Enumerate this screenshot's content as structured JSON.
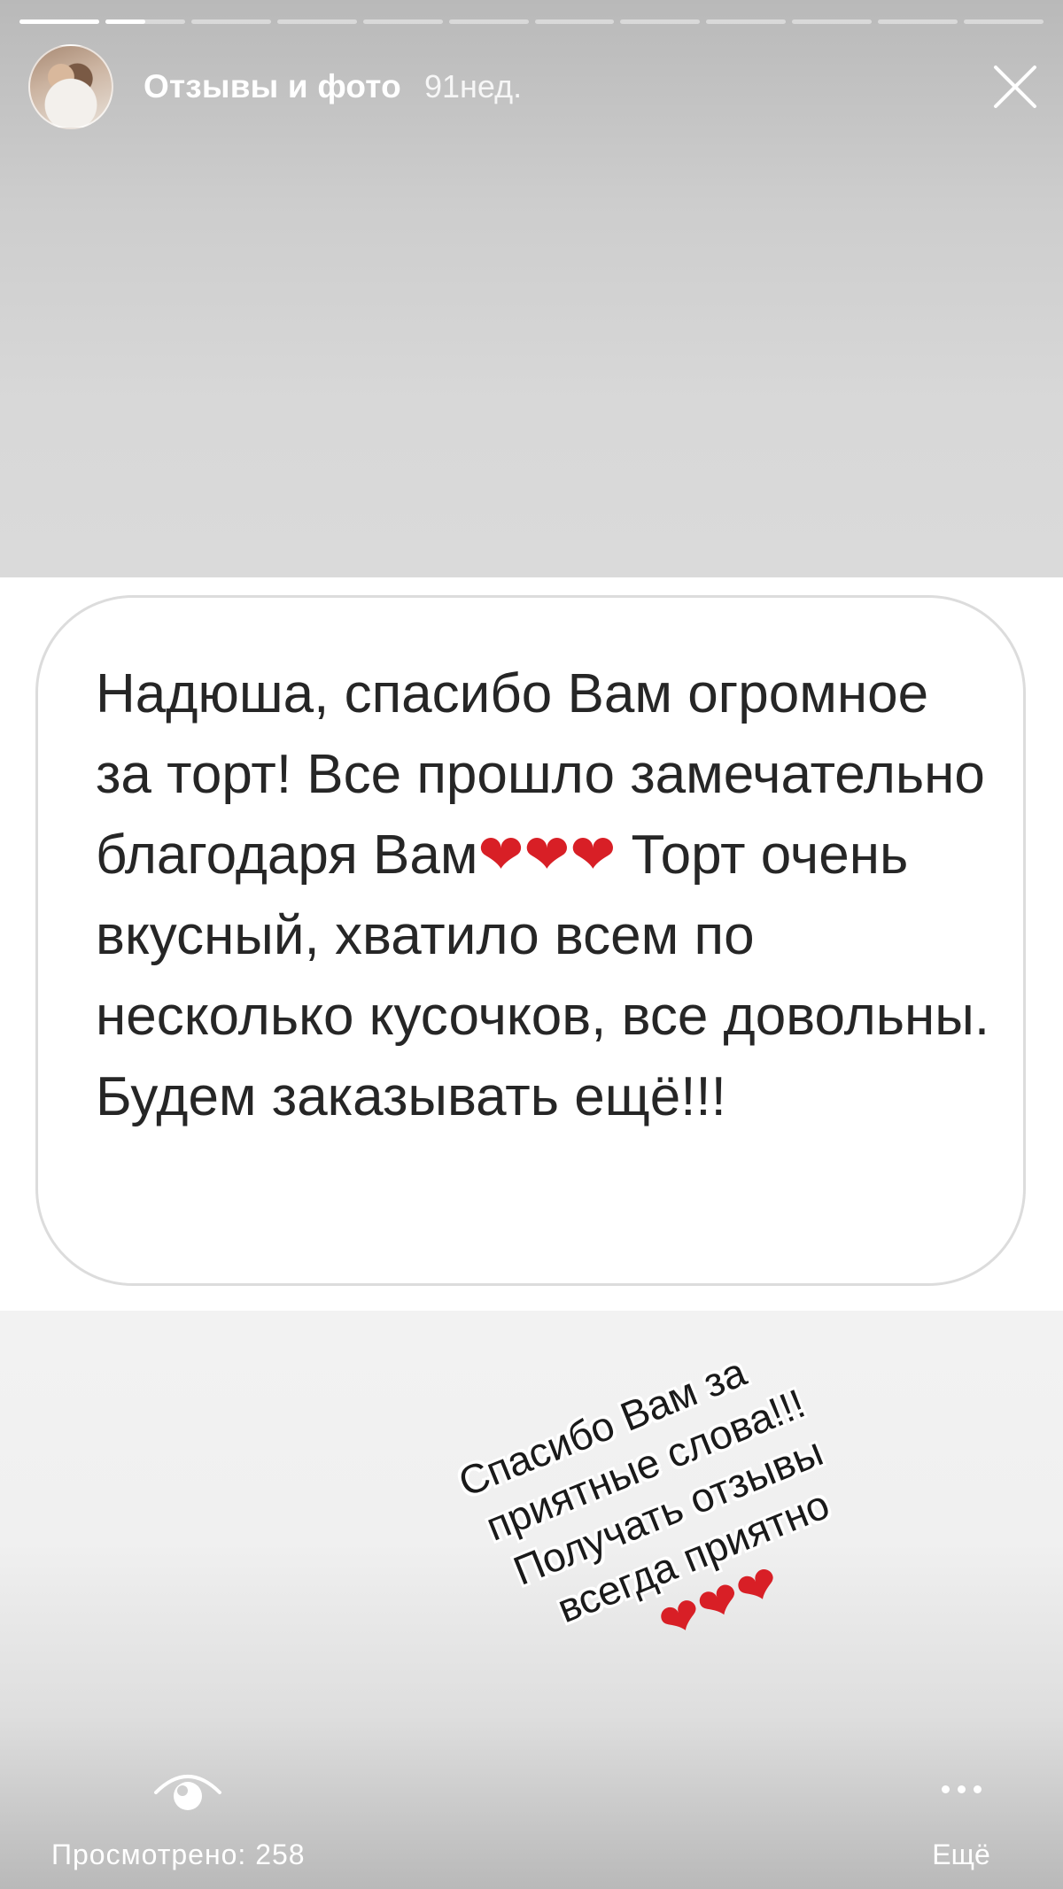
{
  "progress": {
    "segments": 12,
    "current_index": 1,
    "current_fraction": 0.5
  },
  "header": {
    "user_name": "Отзывы и фото",
    "time_ago": "91нед."
  },
  "message": {
    "text_before_hearts": "Надюша, спасибо Вам огромное за торт! Все прошло замечательно благодаря Вам",
    "hearts": "❤❤❤",
    "text_after_hearts": " Торт очень вкусный, хватило всем по несколько кусочков, все довольны. Будем заказывать ещё!!!"
  },
  "reply_sticker": {
    "lines": [
      "Спасибо Вам за",
      "приятные слова!!!",
      "Получать отзывы",
      "всегда приятно"
    ],
    "hearts": "❤❤❤"
  },
  "footer": {
    "views_label": "Просмотрено: 258",
    "more_label": "Ещё"
  },
  "colors": {
    "heart": "#d81f26",
    "text": "#262626"
  },
  "icons": {
    "close": "close-icon",
    "views": "eye-icon",
    "more": "more-dots-icon"
  }
}
